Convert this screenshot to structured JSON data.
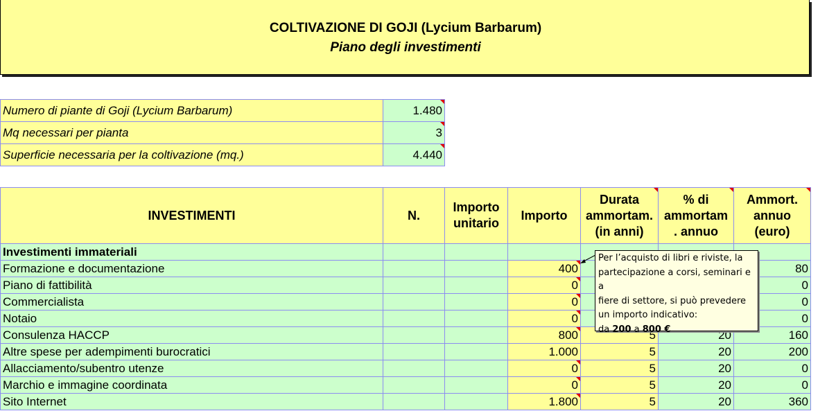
{
  "title": {
    "main": "COLTIVAZIONE DI GOJI (Lycium Barbarum)",
    "subtitle": "Piano degli investimenti"
  },
  "params": [
    {
      "label": "Numero di piante di Goji (Lycium Barbarum)",
      "value": "1.480"
    },
    {
      "label": "Mq necessari per pianta",
      "value": "3"
    },
    {
      "label": "Superficie necessaria per la coltivazione (mq.)",
      "value": "4.440"
    }
  ],
  "headers": {
    "investimenti": "INVESTIMENTI",
    "n": "N.",
    "unit": "Importo unitario",
    "importo": "Importo",
    "durata": "Durata ammortam. (in anni)",
    "perc": "% di ammortam . annuo",
    "annuo": "Ammort. annuo (euro)"
  },
  "section_label": "Investimenti immateriali",
  "rows": [
    {
      "name": "Formazione e documentazione",
      "importo": "400",
      "durata": "",
      "perc": "",
      "annuo": "80"
    },
    {
      "name": "Piano di fattibilità",
      "importo": "0",
      "durata": "",
      "perc": "",
      "annuo": "0"
    },
    {
      "name": "Commercialista",
      "importo": "0",
      "durata": "",
      "perc": "",
      "annuo": "0"
    },
    {
      "name": "Notaio",
      "importo": "0",
      "durata": "",
      "perc": "",
      "annuo": "0"
    },
    {
      "name": "Consulenza HACCP",
      "importo": "800",
      "durata": "5",
      "perc": "20",
      "annuo": "160"
    },
    {
      "name": "Altre spese per adempimenti burocratici",
      "importo": "1.000",
      "durata": "5",
      "perc": "20",
      "annuo": "200"
    },
    {
      "name": "Allacciamento/subentro utenze",
      "importo": "0",
      "durata": "5",
      "perc": "20",
      "annuo": "0"
    },
    {
      "name": "Marchio e immagine coordinata",
      "importo": "0",
      "durata": "5",
      "perc": "20",
      "annuo": "0"
    },
    {
      "name": "Sito Internet",
      "importo": "1.800",
      "durata": "5",
      "perc": "20",
      "annuo": "360"
    }
  ],
  "comment": {
    "line1": "Per l’acquisto di libri e riviste, la",
    "line2": "partecipazione a corsi, seminari e a",
    "line3": "fiere di settore, si può prevedere",
    "line4": "un importo indicativo:",
    "prefix": "da ",
    "min": "200",
    "mid": " a ",
    "max": "800 €"
  }
}
